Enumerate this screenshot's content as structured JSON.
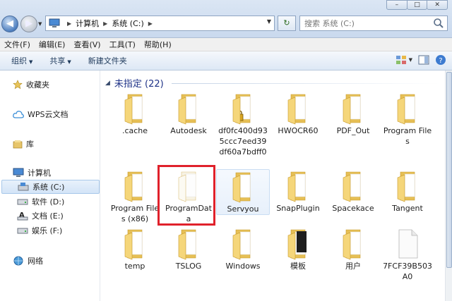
{
  "window": {
    "controls": [
      "–",
      "□",
      "✕"
    ]
  },
  "address": {
    "crumbs": [
      "计算机",
      "系统 (C:)"
    ]
  },
  "search": {
    "placeholder": "搜索 系统 (C:)"
  },
  "menubar": [
    "文件(F)",
    "编辑(E)",
    "查看(V)",
    "工具(T)",
    "帮助(H)"
  ],
  "toolbar": {
    "organize": "组织",
    "share": "共享",
    "new_folder": "新建文件夹"
  },
  "sidebar": {
    "favorites": "收藏夹",
    "wps": "WPS云文档",
    "libraries": "库",
    "computer": "计算机",
    "drives": [
      "系统 (C:)",
      "软件 (D:)",
      "文档 (E:)",
      "娱乐 (F:)"
    ],
    "network": "网络"
  },
  "group": {
    "header": "未指定 (22)"
  },
  "items": [
    {
      "label": ".cache",
      "type": "folder"
    },
    {
      "label": "Autodesk",
      "type": "folder"
    },
    {
      "label": "df0fc400d935ccc7eed39df60a7bdff0",
      "type": "folder-locked"
    },
    {
      "label": "HWOCR60",
      "type": "folder"
    },
    {
      "label": "PDF_Out",
      "type": "folder"
    },
    {
      "label": "Program Files",
      "type": "folder"
    },
    {
      "label": "Program Files (x86)",
      "type": "folder"
    },
    {
      "label": "ProgramData",
      "type": "folder-hidden"
    },
    {
      "label": "Servyou",
      "type": "folder"
    },
    {
      "label": "SnapPlugin",
      "type": "folder"
    },
    {
      "label": "Spacekace",
      "type": "folder"
    },
    {
      "label": "Tangent",
      "type": "folder"
    },
    {
      "label": "temp",
      "type": "folder"
    },
    {
      "label": "TSLOG",
      "type": "folder"
    },
    {
      "label": "Windows",
      "type": "folder"
    },
    {
      "label": "模板",
      "type": "folder-dark"
    },
    {
      "label": "用户",
      "type": "folder"
    },
    {
      "label": "7FCF39B503A0",
      "type": "file"
    }
  ],
  "colors": {
    "accent": "#1e3287",
    "selection_box": "#e0212b"
  }
}
